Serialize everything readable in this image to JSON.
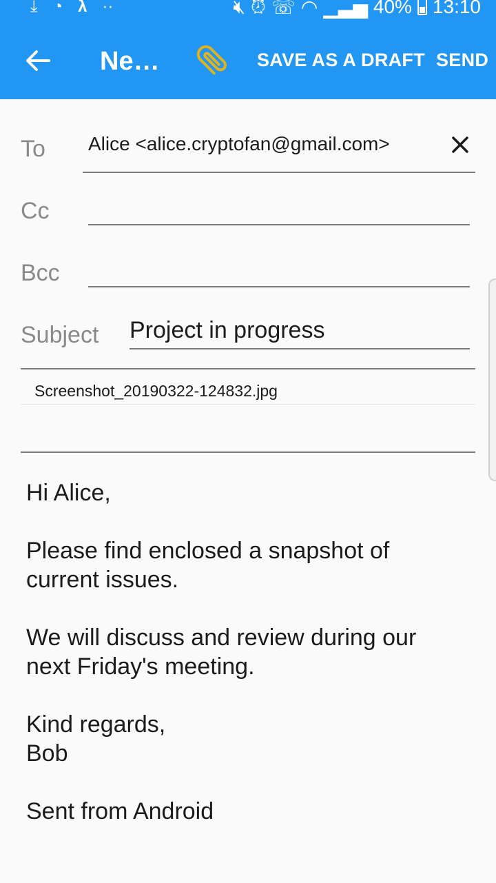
{
  "status_bar": {
    "battery": "40%",
    "time": "13:10"
  },
  "app_bar": {
    "title": "Ne…",
    "save_draft_label": "SAVE AS A DRAFT",
    "send_label": "SEND"
  },
  "form": {
    "to_label": "To",
    "to_value": "Alice <alice.cryptofan@gmail.com>",
    "cc_label": "Cc",
    "bcc_label": "Bcc",
    "subject_label": "Subject",
    "subject_value": "Project in progress"
  },
  "attachment": {
    "filename": "Screenshot_20190322-124832.jpg"
  },
  "body": {
    "greeting": "Hi Alice,",
    "paragraph1_line1": "Please find enclosed a snapshot of",
    "paragraph1_line2": "current issues.",
    "paragraph2_line1": "We will discuss and review during our",
    "paragraph2_line2": "next Friday's meeting.",
    "closing": "Kind regards,",
    "signature": "Bob",
    "footer": "Sent from Android"
  },
  "colors": {
    "primary": "#2196f3",
    "attachment_icon": "#e0b21f"
  },
  "icons": [
    "download-icon",
    "speed-icon",
    "lambda-icon",
    "mute-icon",
    "alarm-icon",
    "wifi-call-icon",
    "wifi-icon",
    "signal-icon",
    "battery-icon",
    "back-arrow-icon",
    "paperclip-icon",
    "close-icon"
  ]
}
